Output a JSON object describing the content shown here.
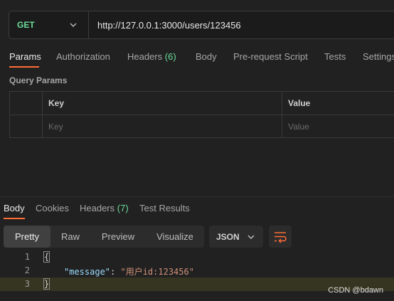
{
  "request": {
    "method": "GET",
    "url": "http://127.0.0.1:3000/users/123456"
  },
  "request_tabs": [
    {
      "label": "Params",
      "active": true
    },
    {
      "label": "Authorization"
    },
    {
      "label": "Headers",
      "count": "(6)"
    },
    {
      "label": "Body"
    },
    {
      "label": "Pre-request Script"
    },
    {
      "label": "Tests"
    },
    {
      "label": "Settings"
    }
  ],
  "query_params": {
    "title": "Query Params",
    "headers": {
      "key": "Key",
      "value": "Value"
    },
    "placeholder": {
      "key": "Key",
      "value": "Value"
    }
  },
  "response_tabs": [
    {
      "label": "Body",
      "active": true
    },
    {
      "label": "Cookies"
    },
    {
      "label": "Headers",
      "count": "(7)"
    },
    {
      "label": "Test Results"
    }
  ],
  "view_modes": [
    {
      "label": "Pretty",
      "active": true
    },
    {
      "label": "Raw"
    },
    {
      "label": "Preview"
    },
    {
      "label": "Visualize"
    }
  ],
  "format": "JSON",
  "body_lines": [
    {
      "num": "1",
      "text": "{"
    },
    {
      "num": "2",
      "key": "\"message\"",
      "sep": ": ",
      "value": "\"用户id:123456\""
    },
    {
      "num": "3",
      "text": "}"
    }
  ],
  "watermark": "CSDN @bdawn",
  "colors": {
    "accent": "#ff6c37",
    "method": "#6bdd9a",
    "count": "#6bdd9a"
  },
  "icons": {
    "method_dropdown": "chevron-down-icon",
    "format_dropdown": "chevron-down-icon",
    "wrap": "wrap-lines-icon"
  }
}
